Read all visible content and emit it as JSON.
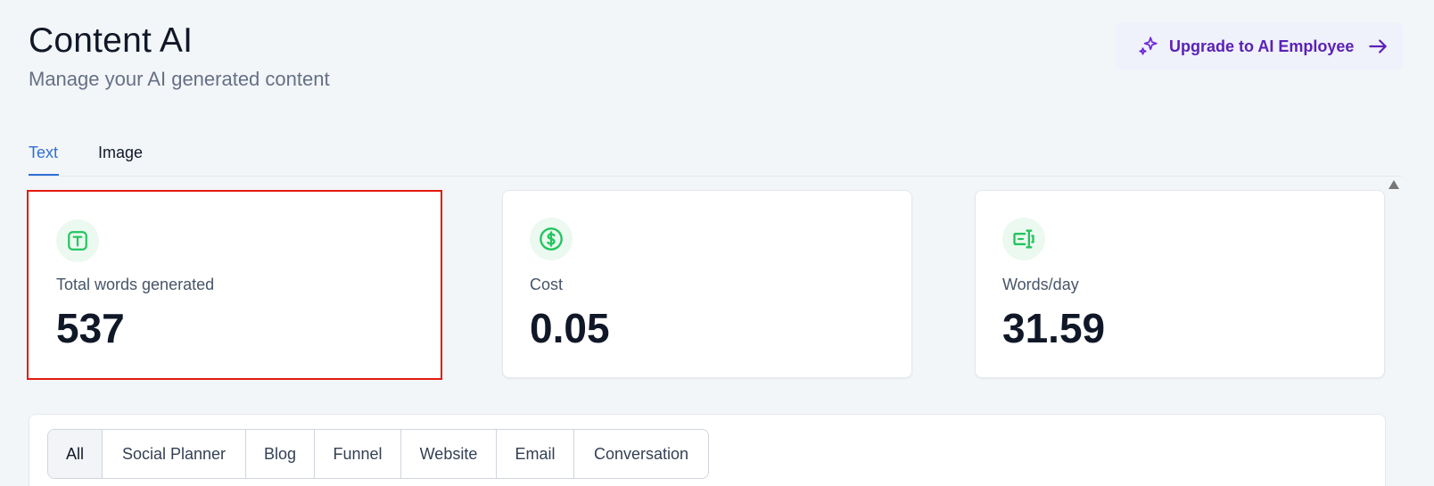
{
  "header": {
    "title": "Content AI",
    "subtitle": "Manage your AI generated content",
    "upgrade_label": "Upgrade to AI Employee"
  },
  "tabs": [
    {
      "label": "Text",
      "active": true
    },
    {
      "label": "Image",
      "active": false
    }
  ],
  "stats": [
    {
      "label": "Total words generated",
      "value": "537",
      "icon": "text-icon"
    },
    {
      "label": "Cost",
      "value": "0.05",
      "icon": "dollar-icon"
    },
    {
      "label": "Words/day",
      "value": "31.59",
      "icon": "words-per-day-icon"
    }
  ],
  "filters": [
    {
      "label": "All",
      "active": true
    },
    {
      "label": "Social Planner",
      "active": false
    },
    {
      "label": "Blog",
      "active": false
    },
    {
      "label": "Funnel",
      "active": false
    },
    {
      "label": "Website",
      "active": false
    },
    {
      "label": "Email",
      "active": false
    },
    {
      "label": "Conversation",
      "active": false
    }
  ],
  "colors": {
    "accent": "#2f6fd4",
    "upgrade_text": "#5b21b6",
    "icon_green": "#22c55e",
    "highlight_border": "#e5190e"
  }
}
